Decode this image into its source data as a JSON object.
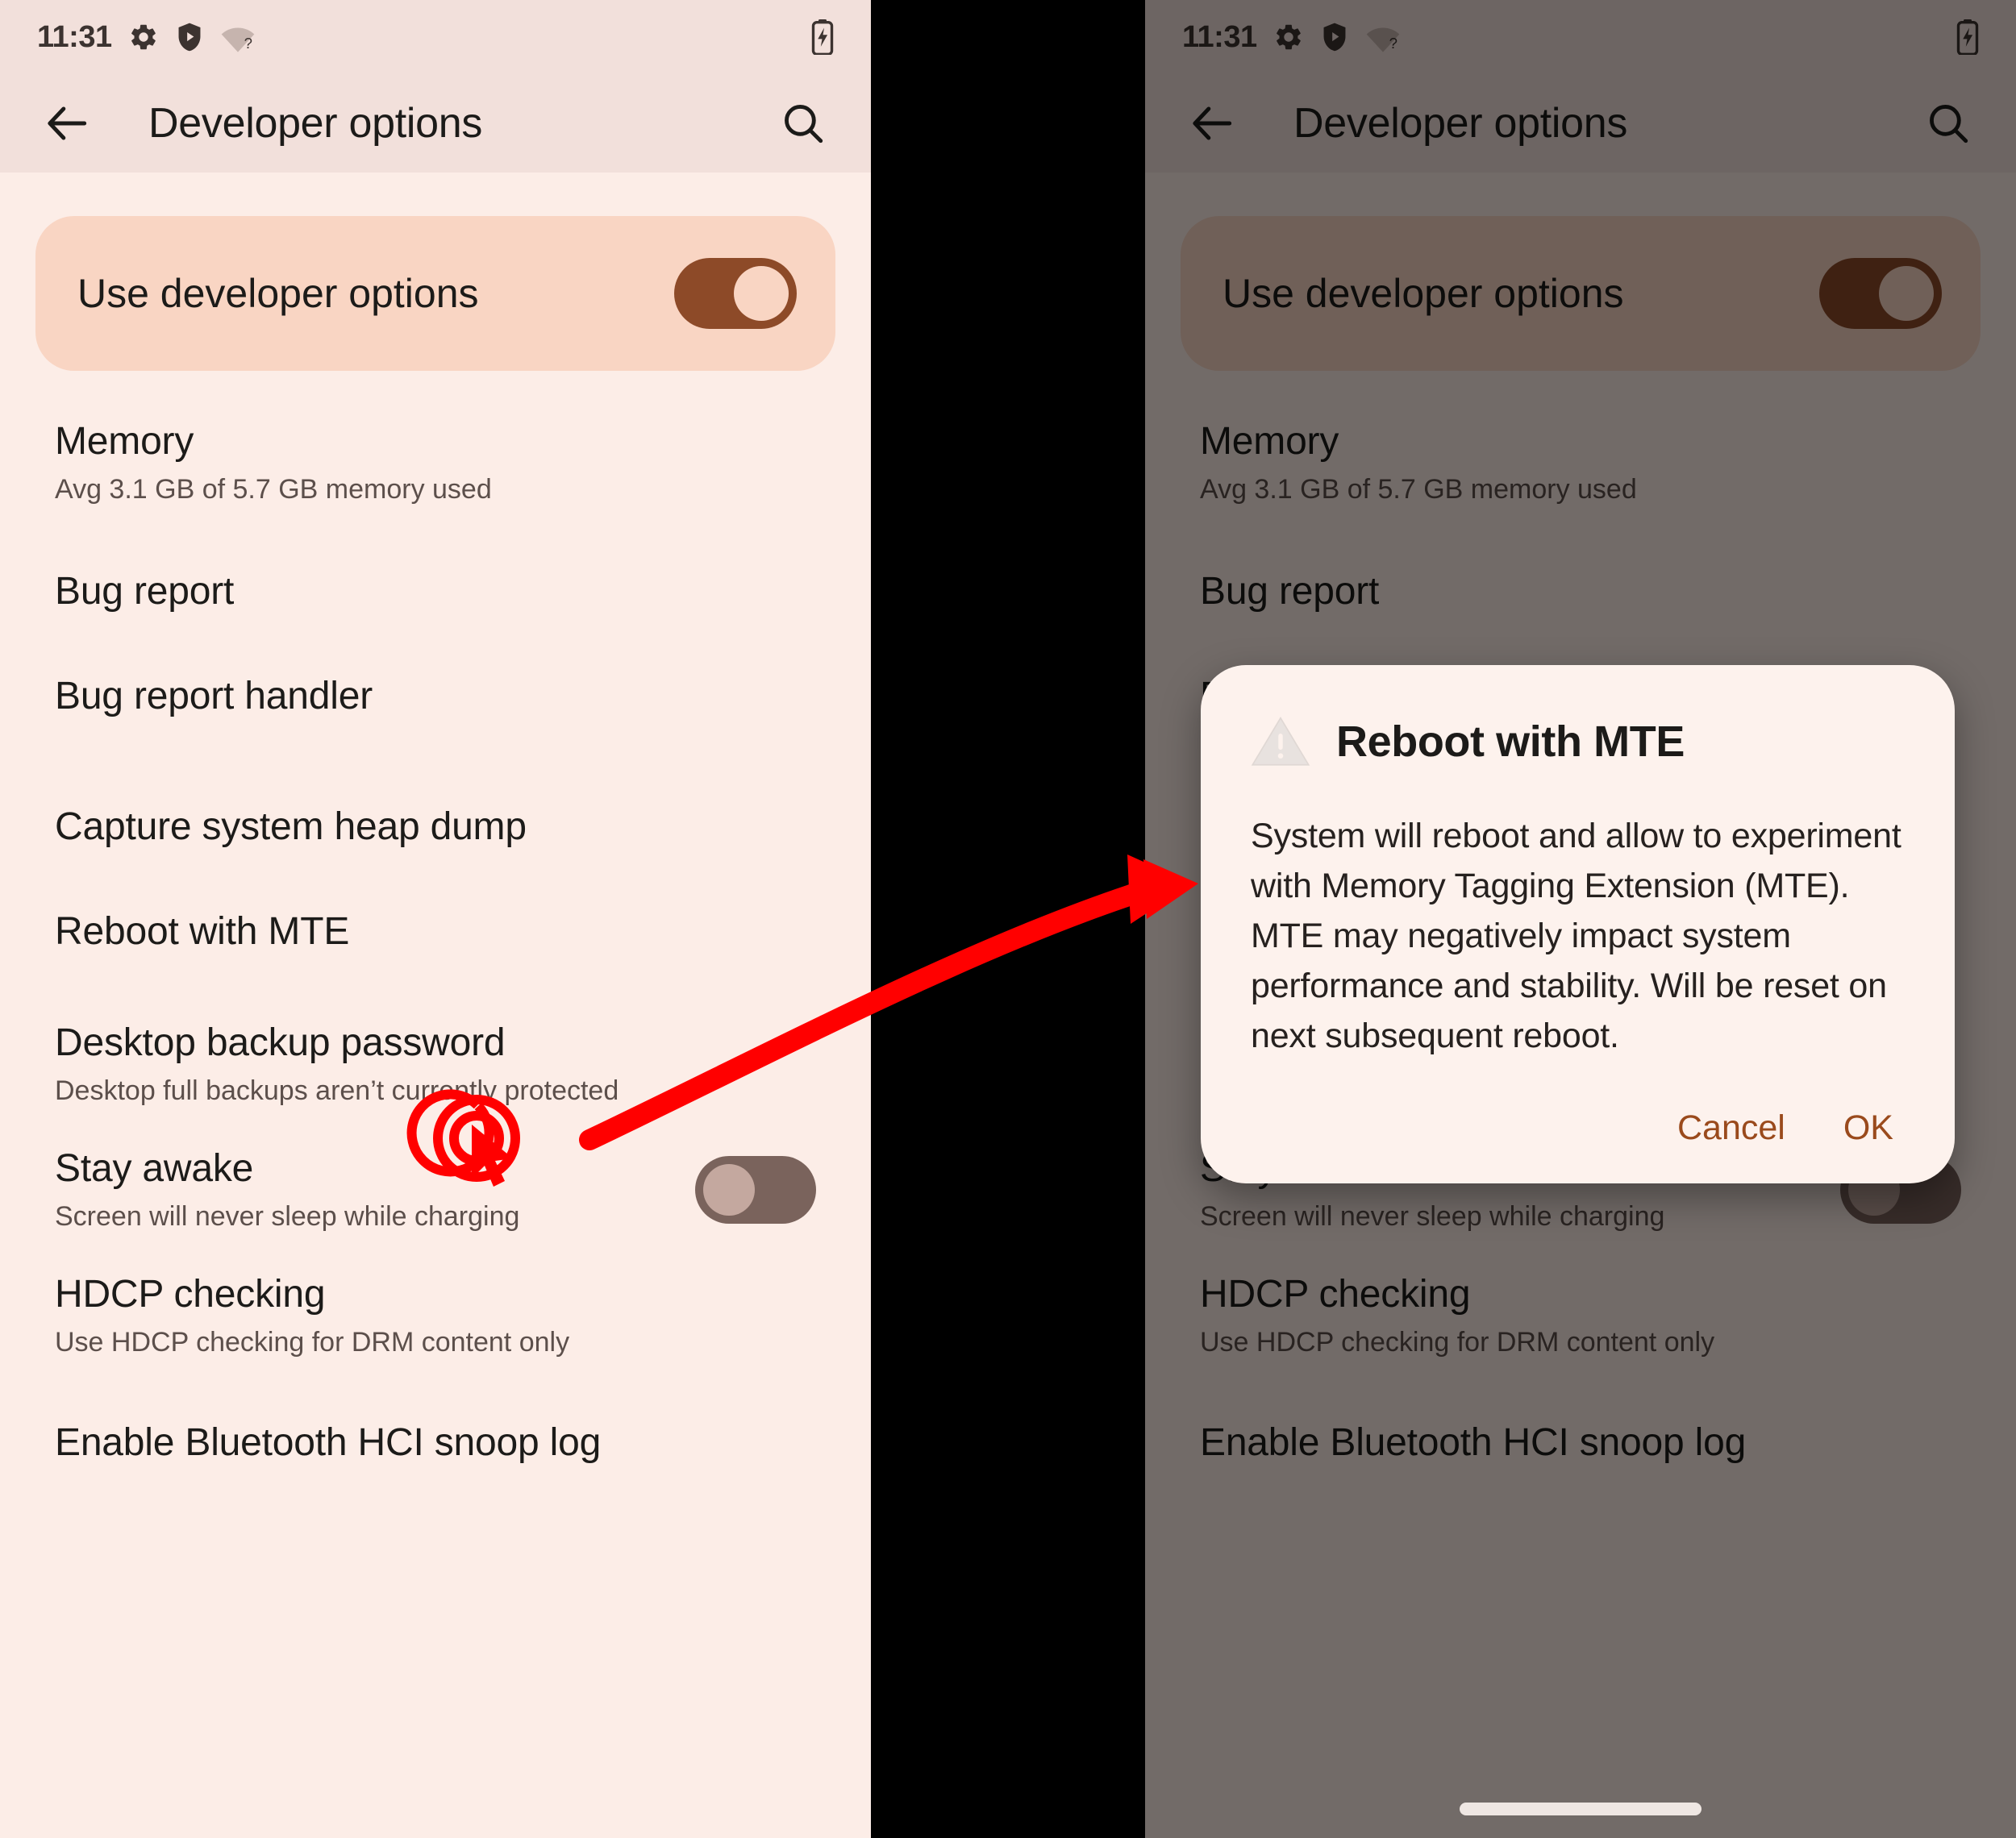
{
  "status_bar": {
    "time": "11:31",
    "icons": [
      "gear-icon",
      "shield-play-icon",
      "wifi-question-icon"
    ],
    "battery_icon": "battery-charging-icon"
  },
  "app_bar": {
    "back_icon": "back-arrow-icon",
    "title": "Developer options",
    "search_icon": "search-icon"
  },
  "hero": {
    "label": "Use developer options",
    "toggle_state": "on",
    "toggle_track_color": "#8D4A28",
    "toggle_thumb_color": "#F9D5C3",
    "card_color": "#F9D5C3"
  },
  "list": [
    {
      "title": "Memory",
      "subtitle": "Avg 3.1 GB of 5.7 GB memory used",
      "control": "none"
    },
    {
      "title": "Bug report",
      "subtitle": "",
      "control": "none"
    },
    {
      "title": "Bug report handler",
      "subtitle": "",
      "control": "none"
    },
    {
      "title": "Capture system heap dump",
      "subtitle": "",
      "control": "none"
    },
    {
      "title": "Reboot with MTE",
      "subtitle": "",
      "control": "none"
    },
    {
      "title": "Desktop backup password",
      "subtitle": "Desktop full backups aren’t currently protected",
      "control": "none"
    },
    {
      "title": "Stay awake",
      "subtitle": "Screen will never sleep while charging",
      "control": "switch-off"
    },
    {
      "title": "HDCP checking",
      "subtitle": "Use HDCP checking for DRM content only",
      "control": "none"
    },
    {
      "title": "Enable Bluetooth HCI snoop log",
      "subtitle": "",
      "control": "none"
    }
  ],
  "dialog": {
    "icon": "warning-triangle-icon",
    "title": "Reboot with MTE",
    "body": "System will reboot and allow to experiment with Memory Tagging Extension (MTE). MTE may negatively impact system performance and stability. Will be reset on next subsequent reboot.",
    "cancel_label": "Cancel",
    "ok_label": "OK",
    "action_color": "#9A4A1C"
  },
  "annotation": {
    "tap_target_label": "Reboot with MTE",
    "tap_icon": "tap-cursor-icon",
    "arrow_icon": "curved-arrow-icon",
    "accent_color": "#FF0000"
  },
  "colors": {
    "surface": "#FCEDE7",
    "app_bar": "#F2E0DB",
    "primary": "#8D4A28",
    "text": "#1C1B19",
    "text_secondary": "#5C4F4B",
    "scrim": "rgba(0,0,0,0.55)",
    "divider_gap": "#000000"
  }
}
